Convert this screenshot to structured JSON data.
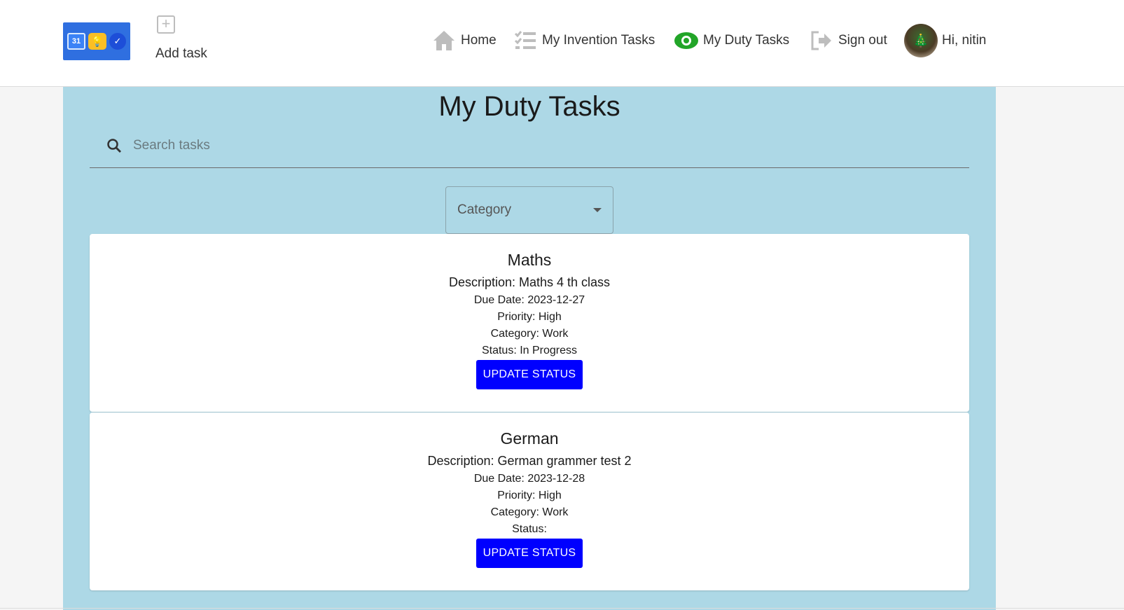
{
  "header": {
    "logo_text": "31",
    "add_task_label": "Add task",
    "nav": {
      "home": "Home",
      "invention": "My Invention Tasks",
      "duty": "My Duty Tasks",
      "signout": "Sign out",
      "user": "Hi, nitin"
    }
  },
  "main": {
    "title": "My Duty Tasks",
    "search_placeholder": "Search tasks",
    "category_label": "Category",
    "tasks": [
      {
        "title": "Maths",
        "description": "Description: Maths 4 th class",
        "due": "Due Date: 2023-12-27",
        "priority": "Priority: High",
        "category": "Category: Work",
        "status": "Status: In Progress",
        "button": "UPDATE STATUS"
      },
      {
        "title": "German",
        "description": "Description: German grammer test 2",
        "due": "Due Date: 2023-12-28",
        "priority": "Priority: High",
        "category": "Category: Work",
        "status": "Status:",
        "button": "UPDATE STATUS"
      }
    ]
  },
  "colors": {
    "accent_blue": "#0000ff",
    "main_bg": "#add8e6",
    "duty_icon_green": "#22a528"
  }
}
